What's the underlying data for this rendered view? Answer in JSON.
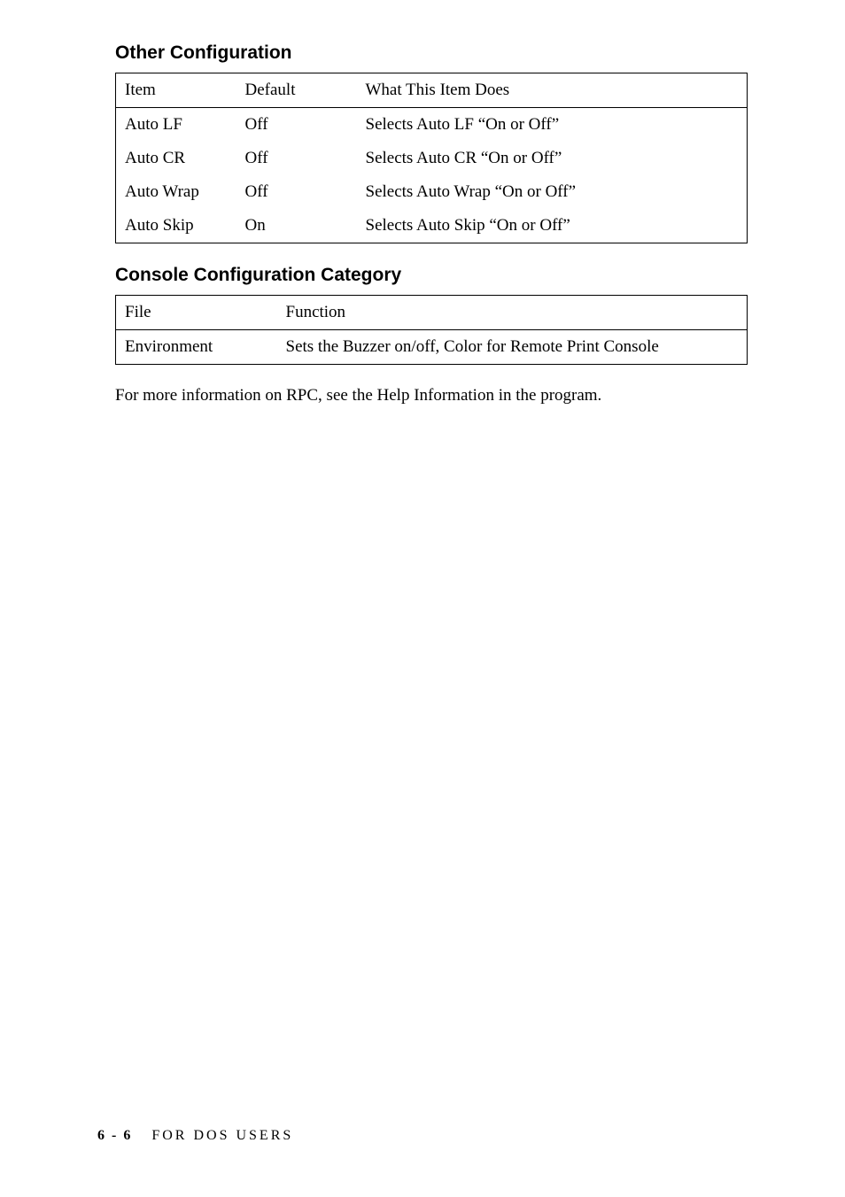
{
  "section1": {
    "heading": "Other Configuration",
    "header": {
      "col1": "Item",
      "col2": "Default",
      "col3": "What This Item Does"
    },
    "rows": [
      {
        "item": "Auto LF",
        "default": "Off",
        "desc": "Selects Auto LF “On or Off”"
      },
      {
        "item": "Auto CR",
        "default": "Off",
        "desc": "Selects Auto CR “On or Off”"
      },
      {
        "item": "Auto Wrap",
        "default": "Off",
        "desc": "Selects Auto Wrap “On or Off”"
      },
      {
        "item": "Auto Skip",
        "default": "On",
        "desc": "Selects Auto Skip “On or Off”"
      }
    ]
  },
  "section2": {
    "heading": "Console Configuration Category",
    "header": {
      "col1": "File",
      "col2": "Function"
    },
    "rows": [
      {
        "file": "Environment",
        "func": "Sets the Buzzer on/off, Color for Remote Print Console"
      }
    ]
  },
  "body_text": "For more information on RPC, see the Help Information in the program.",
  "footer": {
    "page": "6 - 6",
    "section": "FOR DOS USERS"
  }
}
